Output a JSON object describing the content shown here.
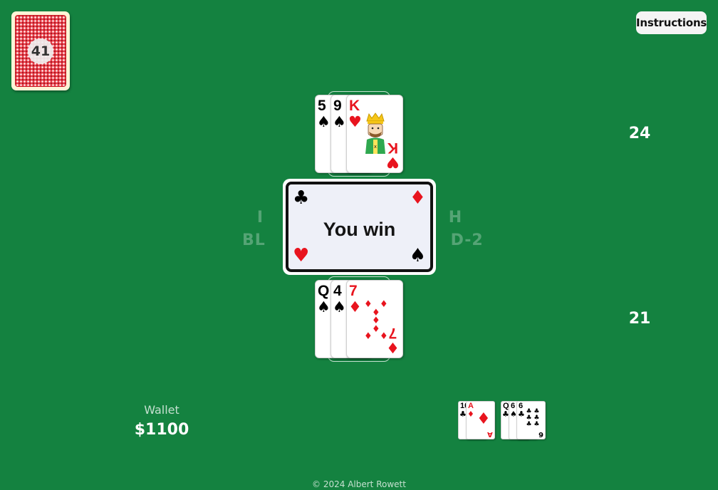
{
  "colors": {
    "felt": "#148240",
    "red": "#e8141e",
    "black": "#000000"
  },
  "deck": {
    "count": "41",
    "icon": "card-back-icon"
  },
  "instructions_label": "Instructions",
  "dealer": {
    "score": "24",
    "cards": [
      {
        "rank": "5",
        "suit": "♠",
        "color": "black"
      },
      {
        "rank": "9",
        "suit": "♠",
        "color": "black"
      },
      {
        "rank": "K",
        "suit": "♥",
        "color": "red"
      }
    ]
  },
  "player": {
    "score": "21",
    "cards": [
      {
        "rank": "Q",
        "suit": "♠",
        "color": "black"
      },
      {
        "rank": "4",
        "suit": "♠",
        "color": "black"
      },
      {
        "rank": "7",
        "suit": "♦",
        "color": "red"
      }
    ]
  },
  "table_text": {
    "line1": "I                              H",
    "line2": "BL                              D-2"
  },
  "result": {
    "text": "You win",
    "suits": {
      "tl": "♣",
      "tr": "♦",
      "bl": "♥",
      "br": "♠"
    }
  },
  "wallet": {
    "label": "Wallet",
    "amount": "$1100"
  },
  "history": [
    {
      "cards": [
        {
          "rank": "10",
          "suit": "♣",
          "color": "black"
        },
        {
          "rank": "A",
          "suit": "♦",
          "color": "red"
        }
      ]
    },
    {
      "cards": [
        {
          "rank": "Q",
          "suit": "♣",
          "color": "black"
        },
        {
          "rank": "6",
          "suit": "♠",
          "color": "black"
        },
        {
          "rank": "6",
          "suit": "♣",
          "color": "black"
        }
      ]
    }
  ],
  "footer": "© 2024 Albert Rowett"
}
